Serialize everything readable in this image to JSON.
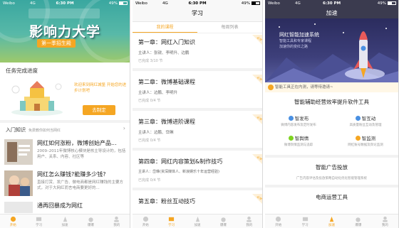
{
  "status": {
    "carrier": "Weibo",
    "network": "4G",
    "time": "6:30 PM",
    "battery": "49%",
    "battery_level": 0.49
  },
  "colors": {
    "accent": "#f5a623",
    "dark_banner": "#2b2c5e",
    "teal_banner": "#3aa7a0"
  },
  "screen1": {
    "banner_title": "影响力大学",
    "banner_subtitle": "第一季招生殿",
    "progress_section_title": "任务完成进度",
    "welcome_text": "欢迎来到网红城堡 开始您的进步计划吧",
    "plan_button": "去制定",
    "course_section_title": "入门知识",
    "course_section_hint": "免费教你如何当网红",
    "courses": [
      {
        "title": "网红如何涨粉，微博创始产品...",
        "desc": "2009–2011年微博核心模块是核主导设计的，包括用户、关系、内容、社区等"
      },
      {
        "title": "网红怎么赚钱?能赚多少钱?",
        "desc": "直接打赏、发广告、做电商都是网红赚钱的主要方式，对于大网红而言电商要更好的..."
      },
      {
        "title": "通再回暴成为网红",
        "desc": ""
      }
    ]
  },
  "screen2": {
    "title": "学习",
    "tabs": [
      "我的课程",
      "每周列表"
    ],
    "chapters": [
      {
        "title": "第一章：网红入门知识",
        "speaker": "主讲人：张锐、李明升、边鹏",
        "lessons": "已完成 3/10 节",
        "badge": "必学"
      },
      {
        "title": "第二章：微博基础课程",
        "speaker": "主讲人：边鹏、李明升",
        "lessons": "已完成 0/4 节",
        "badge": "必学"
      },
      {
        "title": "第三章：微博进阶课程",
        "speaker": "主讲人：边鹏、岱琳",
        "lessons": "已完成 0/4 节",
        "badge": "必学"
      },
      {
        "title": "第四章：网红内容策划&制作技巧",
        "speaker": "主讲人：岱琳(资深媒体人、新浪娱乐十年运营经验)",
        "lessons": "已完成 0/4 节",
        "badge": "必学"
      },
      {
        "title": "第五章：粉丝互动技巧",
        "speaker": "",
        "lessons": "",
        "badge": "必学"
      }
    ]
  },
  "screen3": {
    "title": "加速",
    "banner_title": "网红智能加速系统",
    "banner_sub1": "智能工具和专家课程",
    "banner_sub2": "加速你的变红之路",
    "notice": "智能工具正在内测，请等待邀请~",
    "tools_title": "智能辅助经营效率提升软件工具",
    "tools": [
      {
        "name": "智发布",
        "desc": "微博内容发布及定时发布",
        "color": "#4a90e2"
      },
      {
        "name": "智互动",
        "desc": "高质量粉丝互动及管理",
        "color": "#4a90e2"
      },
      {
        "name": "智舆情",
        "desc": "微博舆情监测与追踪",
        "color": "#7ed321"
      },
      {
        "name": "智监测",
        "desc": "网红账号数据及舆论监测",
        "color": "#f5a623"
      }
    ],
    "ad_title": "智能广告投放",
    "ad_desc": "广告内容评估及投放策略自动化优化智能管理系统",
    "ecom_title": "电商运营工具"
  },
  "tabbar": {
    "items": [
      "开始",
      "学习",
      "加速",
      "爆爆",
      "我的"
    ]
  }
}
